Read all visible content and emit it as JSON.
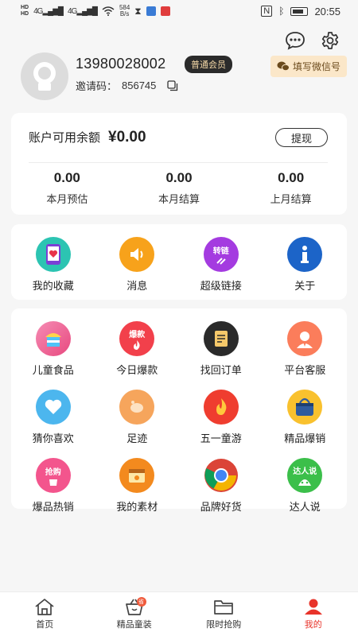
{
  "status_bar": {
    "hd1": "HD",
    "hd2": "HD",
    "net1": "4G",
    "net2": "4G",
    "speed_value": "584",
    "speed_unit": "B/s",
    "time": "20:55",
    "battery_icon": "battery-icon"
  },
  "header": {
    "phone": "13980028002",
    "member_level": "普通会员",
    "invite_label": "邀请码：",
    "invite_code": "856745",
    "wechat_button": "填写微信号"
  },
  "balance": {
    "label": "账户可用余额",
    "amount": "¥0.00",
    "withdraw_label": "提现",
    "stats": [
      {
        "value": "0.00",
        "label": "本月预估"
      },
      {
        "value": "0.00",
        "label": "本月结算"
      },
      {
        "value": "0.00",
        "label": "上月结算"
      }
    ]
  },
  "grid1": [
    {
      "label": "我的收藏",
      "icon": "favorite-phone-icon",
      "color": "#2cc4b2"
    },
    {
      "label": "消息",
      "icon": "speaker-icon",
      "color": "#f7a21b"
    },
    {
      "label": "超级链接",
      "icon": "link-icon",
      "icon_text": "转链",
      "color": "#a43be0"
    },
    {
      "label": "关于",
      "icon": "info-icon",
      "color": "#1c64c8"
    }
  ],
  "grid2": [
    {
      "label": "儿童食品",
      "icon": "kids-food-icon",
      "color": "#e8497f"
    },
    {
      "label": "今日爆款",
      "icon": "hot-today-icon",
      "icon_text": "爆款",
      "color": "#f2404b"
    },
    {
      "label": "找回订单",
      "icon": "order-icon",
      "color": "#2a2a2a"
    },
    {
      "label": "平台客服",
      "icon": "customer-service-icon",
      "color": "#fb7d5b"
    },
    {
      "label": "猜你喜欢",
      "icon": "heart-icon",
      "color": "#4cb6ee"
    },
    {
      "label": "足迹",
      "icon": "footprint-icon",
      "color": "#f6a55c"
    },
    {
      "label": "五一童游",
      "icon": "fire-icon",
      "color": "#ef3d2f"
    },
    {
      "label": "精品爆销",
      "icon": "bag-icon",
      "color": "#2f5b9e"
    },
    {
      "label": "爆品热销",
      "icon": "rush-buy-icon",
      "icon_text": "抢购",
      "color": "#f3558d"
    },
    {
      "label": "我的素材",
      "icon": "material-icon",
      "color": "#f38a1e"
    },
    {
      "label": "品牌好货",
      "icon": "chrome-icon",
      "color": "#4285f4"
    },
    {
      "label": "达人说",
      "icon": "talent-icon",
      "icon_text": "达人说",
      "color": "#3bbf4a"
    }
  ],
  "bottom_nav": [
    {
      "label": "首页",
      "icon": "home-icon"
    },
    {
      "label": "精品童装",
      "icon": "basket-icon",
      "badge": "省"
    },
    {
      "label": "限时抢购",
      "icon": "folder-icon"
    },
    {
      "label": "我的",
      "icon": "profile-icon"
    }
  ]
}
